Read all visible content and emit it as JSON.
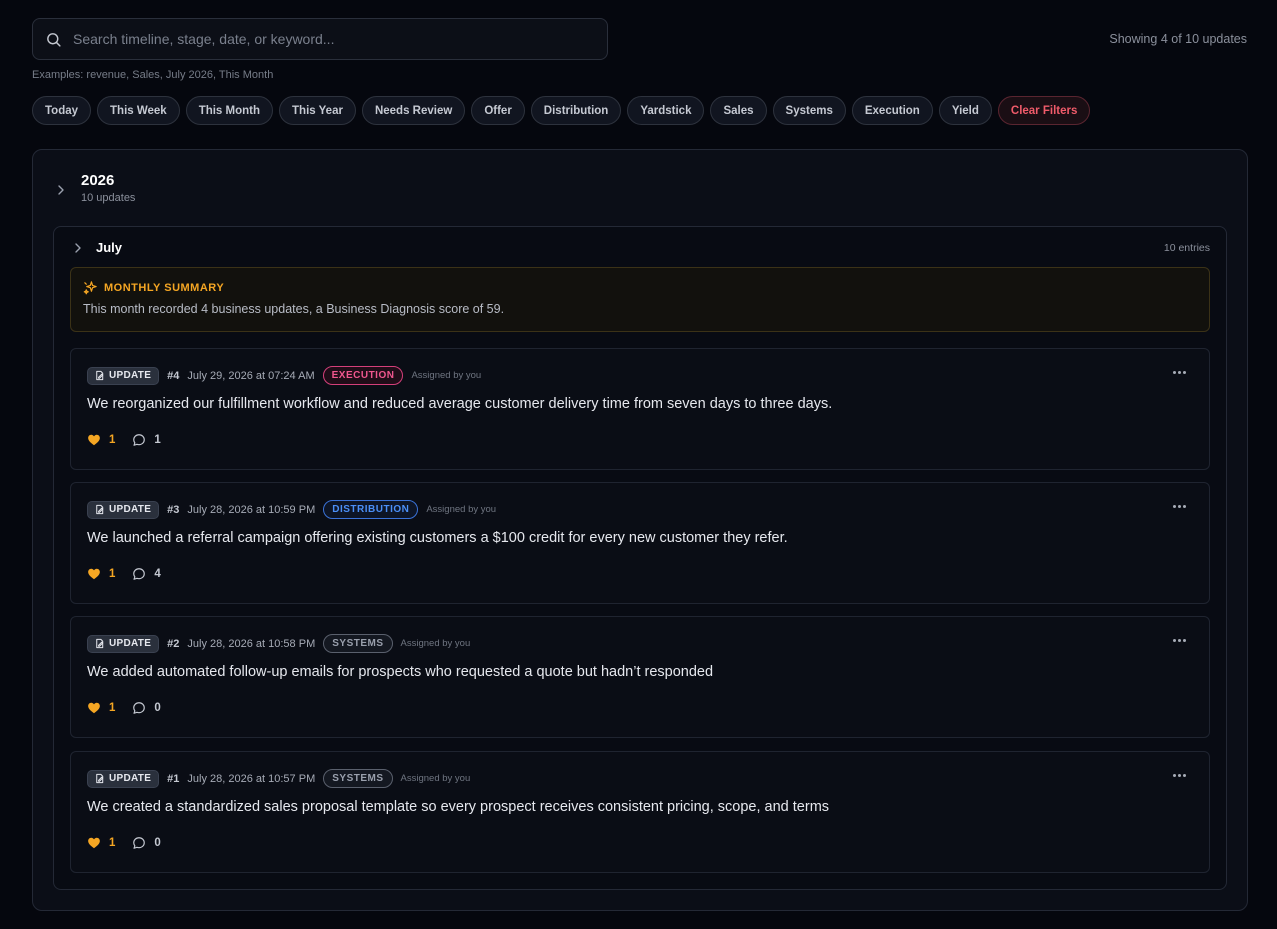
{
  "search": {
    "placeholder": "Search timeline, stage, date, or keyword...",
    "value": "",
    "examples": "Examples: revenue, Sales, July 2026, This Month"
  },
  "showing": "Showing 4 of 10 updates",
  "chips": [
    "Today",
    "This Week",
    "This Month",
    "This Year",
    "Needs Review",
    "Offer",
    "Distribution",
    "Yardstick",
    "Sales",
    "Systems",
    "Execution",
    "Yield"
  ],
  "clear_filters": "Clear Filters",
  "year": {
    "title": "2026",
    "subtitle": "10 updates"
  },
  "month": {
    "title": "July",
    "count": "10 entries"
  },
  "summary": {
    "title": "MONTHLY SUMMARY",
    "text": "This month recorded 4 business updates, a Business Diagnosis score of 59."
  },
  "entries": [
    {
      "type": "UPDATE",
      "number": "#4",
      "date": "July 29, 2026 at 07:24 AM",
      "tag": "EXECUTION",
      "assigned": "Assigned by you",
      "text": "We reorganized our fulfillment workflow and reduced average customer delivery time from seven days to three days.",
      "likes": "1",
      "comments": "1"
    },
    {
      "type": "UPDATE",
      "number": "#3",
      "date": "July 28, 2026 at 10:59 PM",
      "tag": "DISTRIBUTION",
      "assigned": "Assigned by you",
      "text": "We launched a referral campaign offering existing customers a $100 credit for every new customer they refer.",
      "likes": "1",
      "comments": "4"
    },
    {
      "type": "UPDATE",
      "number": "#2",
      "date": "July 28, 2026 at 10:58 PM",
      "tag": "SYSTEMS",
      "assigned": "Assigned by you",
      "text": "We added automated follow-up emails for prospects who requested a quote but hadn’t responded",
      "likes": "1",
      "comments": "0"
    },
    {
      "type": "UPDATE",
      "number": "#1",
      "date": "July 28, 2026 at 10:57 PM",
      "tag": "SYSTEMS",
      "assigned": "Assigned by you",
      "text": "We created a standardized sales proposal template so every prospect receives consistent pricing, scope, and terms",
      "likes": "1",
      "comments": "0"
    }
  ],
  "colors": {
    "background": "#05070e",
    "accent_orange": "#f5a623",
    "execution_pink": "#f0578f",
    "distribution_blue": "#4b8ff7",
    "clear_red": "#f05b6a"
  },
  "icons": {
    "search": "search-icon",
    "chevron": "chevron-right-icon",
    "summary": "sparkles-icon",
    "update": "edit-document-icon",
    "like": "heart-icon",
    "comment": "comment-icon",
    "menu": "more-horizontal-icon"
  }
}
